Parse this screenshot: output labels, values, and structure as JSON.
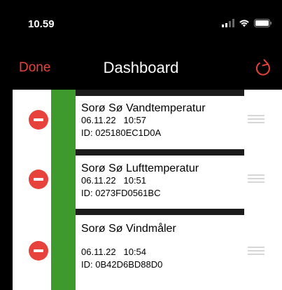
{
  "status_bar": {
    "time": "10.59",
    "icons": [
      "signal-icon",
      "wifi-icon",
      "battery-icon"
    ]
  },
  "nav": {
    "done_label": "Done",
    "title": "Dashboard",
    "refresh_icon": "refresh-icon"
  },
  "colors": {
    "accent": "#e8423c",
    "sensor_bar": "#3e9a2d",
    "separator": "#1c1c1c"
  },
  "sensors": [
    {
      "name": "Sorø Sø Vandtemperatur",
      "date": "06.11.22",
      "time": "10:57",
      "id": "ID: 025180EC1D0A"
    },
    {
      "name": "Sorø Sø Lufttemperatur",
      "date": "06.11.22",
      "time": "10:51",
      "id": "ID: 0273FD0561BC"
    },
    {
      "name": "Sorø Sø Vindmåler",
      "date": "06.11.22",
      "time": "10:54",
      "id": "ID: 0B42D6BD88D0"
    }
  ]
}
